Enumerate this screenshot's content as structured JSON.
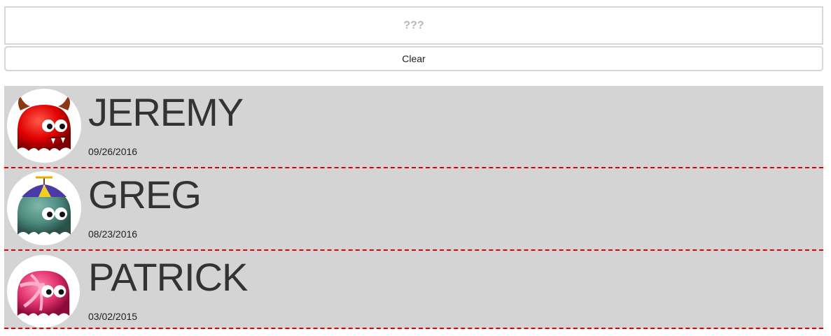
{
  "search": {
    "value": "???"
  },
  "clear_label": "Clear",
  "people": [
    {
      "name": "JEREMY",
      "date": "09/26/2016",
      "avatar": "red-devil-monster-icon",
      "color": "#e00000"
    },
    {
      "name": "GREG",
      "date": "08/23/2016",
      "avatar": "teal-propeller-cap-monster-icon",
      "color": "#4e8b7f"
    },
    {
      "name": "PATRICK",
      "date": "03/02/2015",
      "avatar": "pink-candy-swirl-monster-icon",
      "color": "#e0306a"
    }
  ]
}
